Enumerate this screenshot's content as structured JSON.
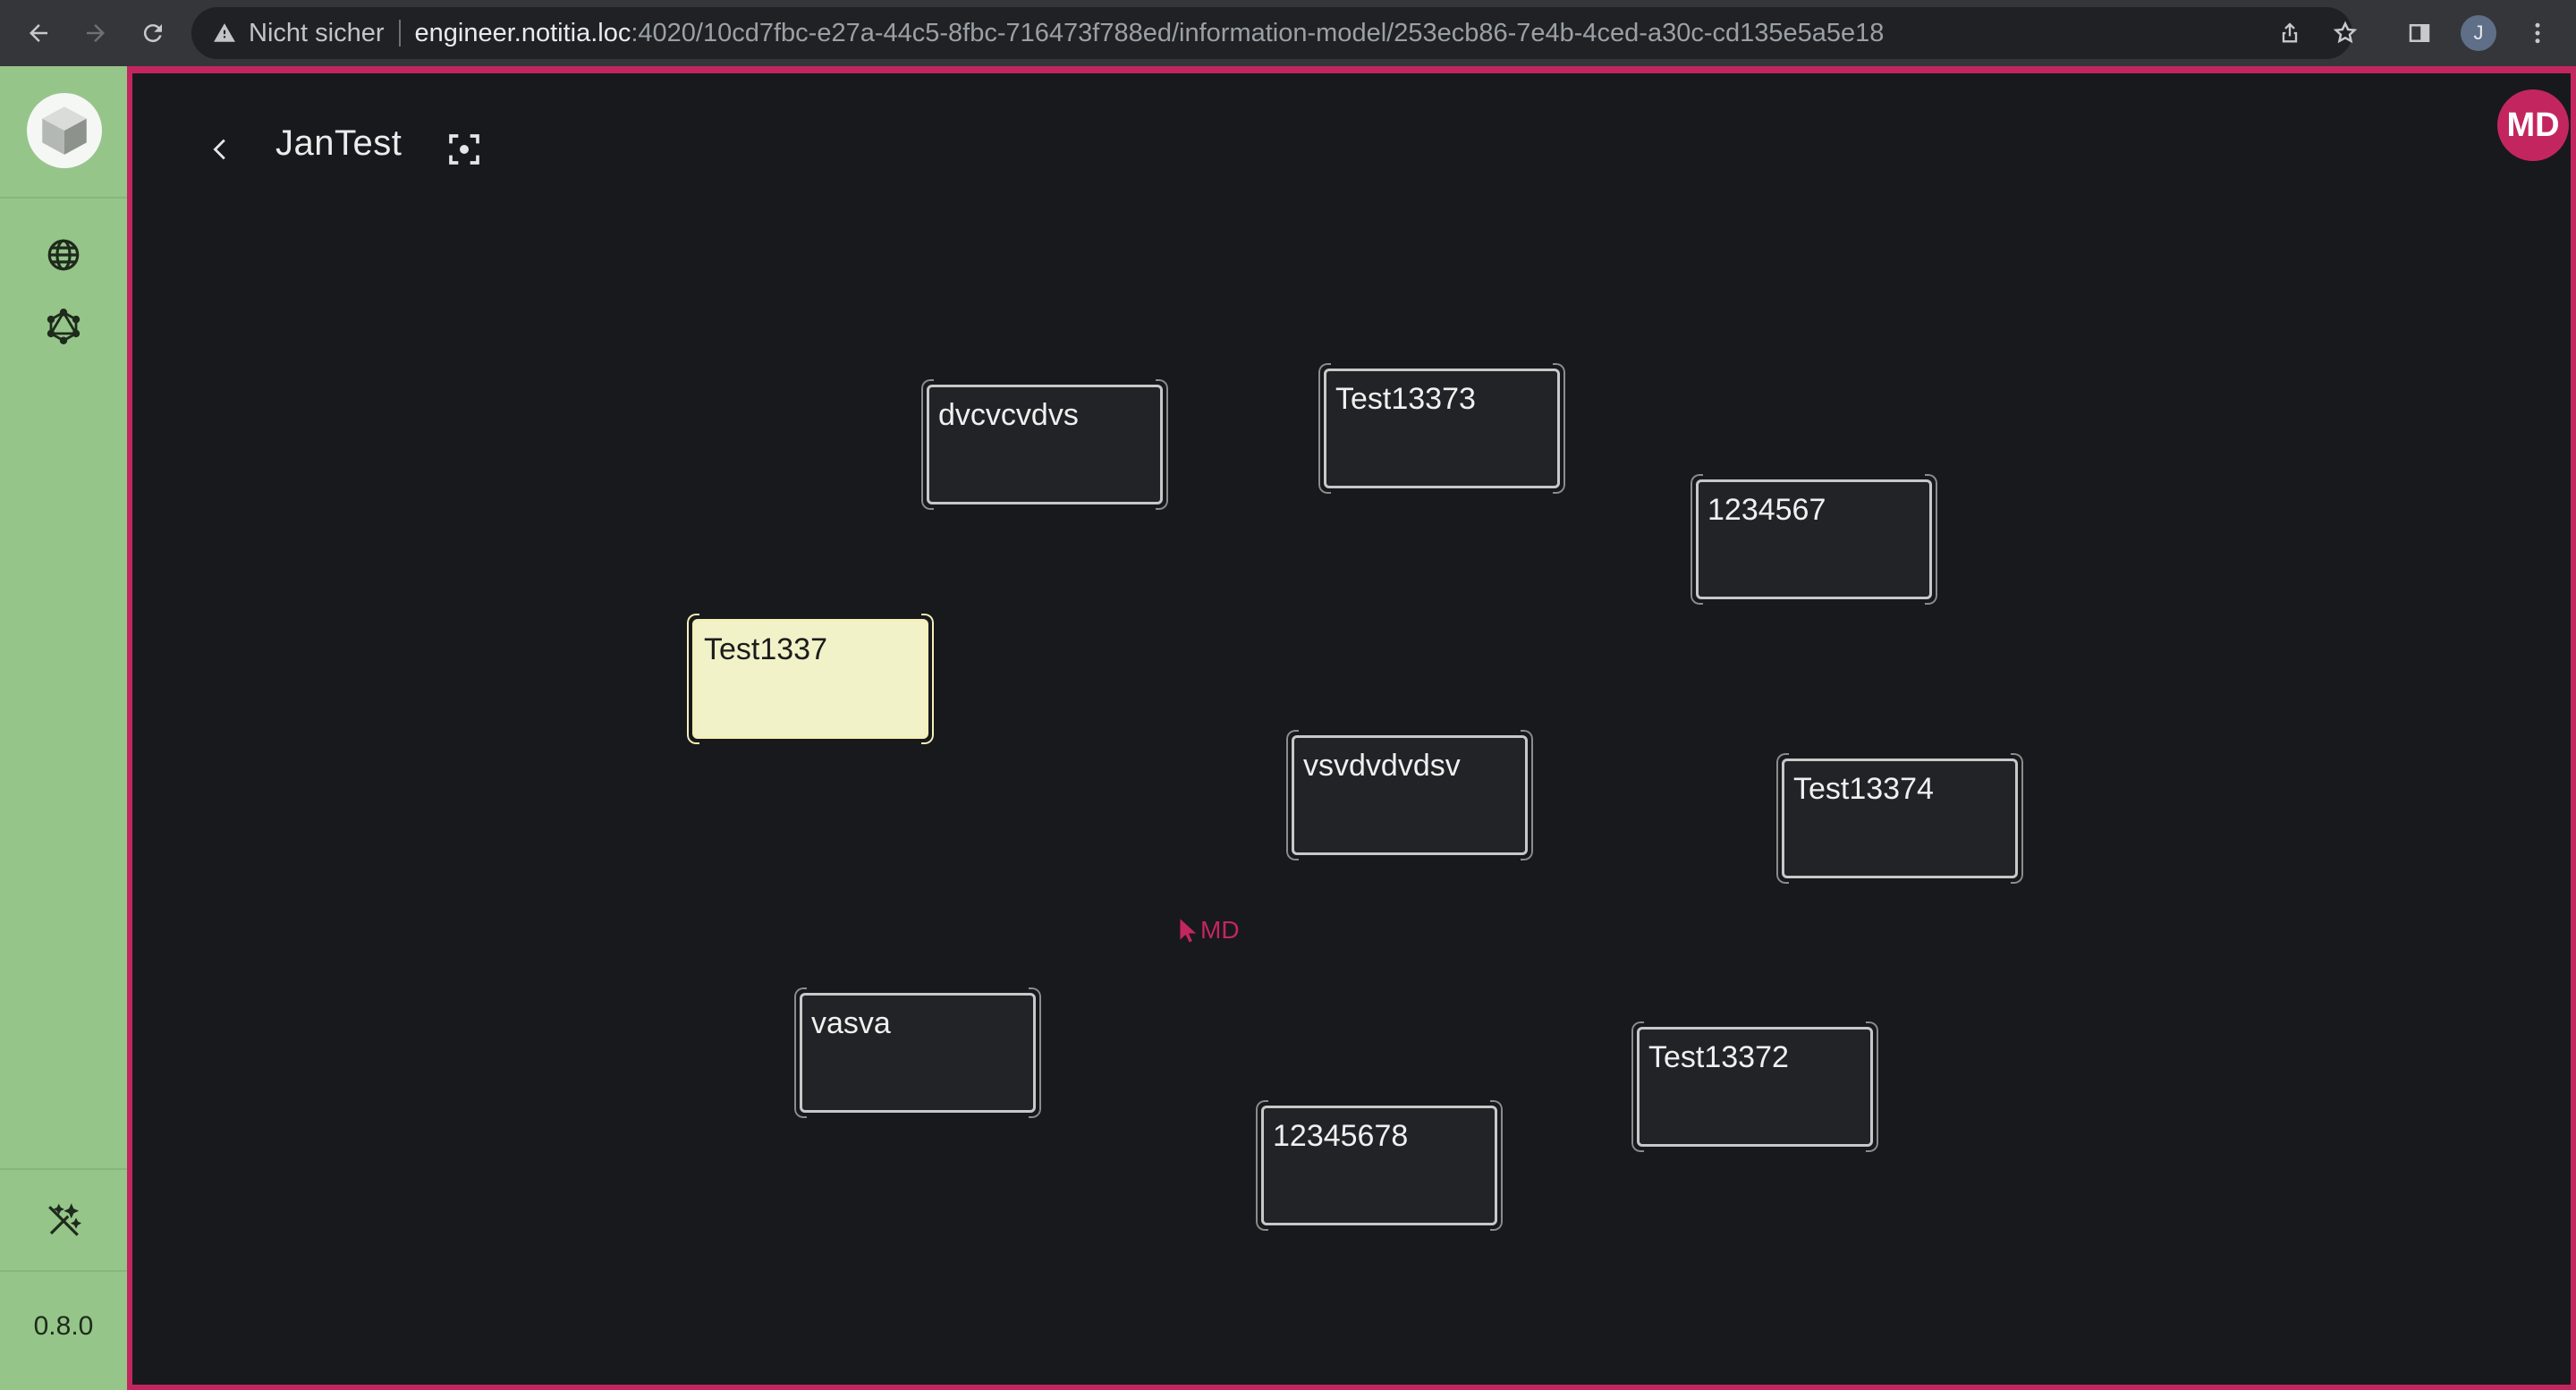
{
  "browser": {
    "security_text": "Nicht sicher",
    "url_host": "engineer.notitia.loc",
    "url_path": ":4020/10cd7fbc-e27a-44c5-8fbc-716473f788ed/information-model/253ecb86-7e4b-4ced-a30c-cd135e5a5e18",
    "profile_initial": "J"
  },
  "sidebar": {
    "items": [
      {
        "icon": "globe-icon"
      },
      {
        "icon": "graph-icon"
      }
    ],
    "bottom_icon": "magic-wand-off-icon",
    "version": "0.8.0"
  },
  "header": {
    "title": "JanTest",
    "avatar_initials": "MD"
  },
  "nodes": [
    {
      "label": "dvcvcvdvs",
      "selected": false
    },
    {
      "label": "Test13373",
      "selected": false
    },
    {
      "label": "1234567",
      "selected": false
    },
    {
      "label": "Test1337",
      "selected": true
    },
    {
      "label": "vsvdvdvdsv",
      "selected": false
    },
    {
      "label": "Test13374",
      "selected": false
    },
    {
      "label": "vasva",
      "selected": false
    },
    {
      "label": "Test13372",
      "selected": false
    },
    {
      "label": "12345678",
      "selected": false
    }
  ],
  "collaborator_cursor": {
    "initials": "MD",
    "color": "#c3265f"
  },
  "colors": {
    "sidebar": "#96c58a",
    "accent": "#c3265f",
    "canvas": "#18191c",
    "selected_node": "#f1f2c8"
  }
}
